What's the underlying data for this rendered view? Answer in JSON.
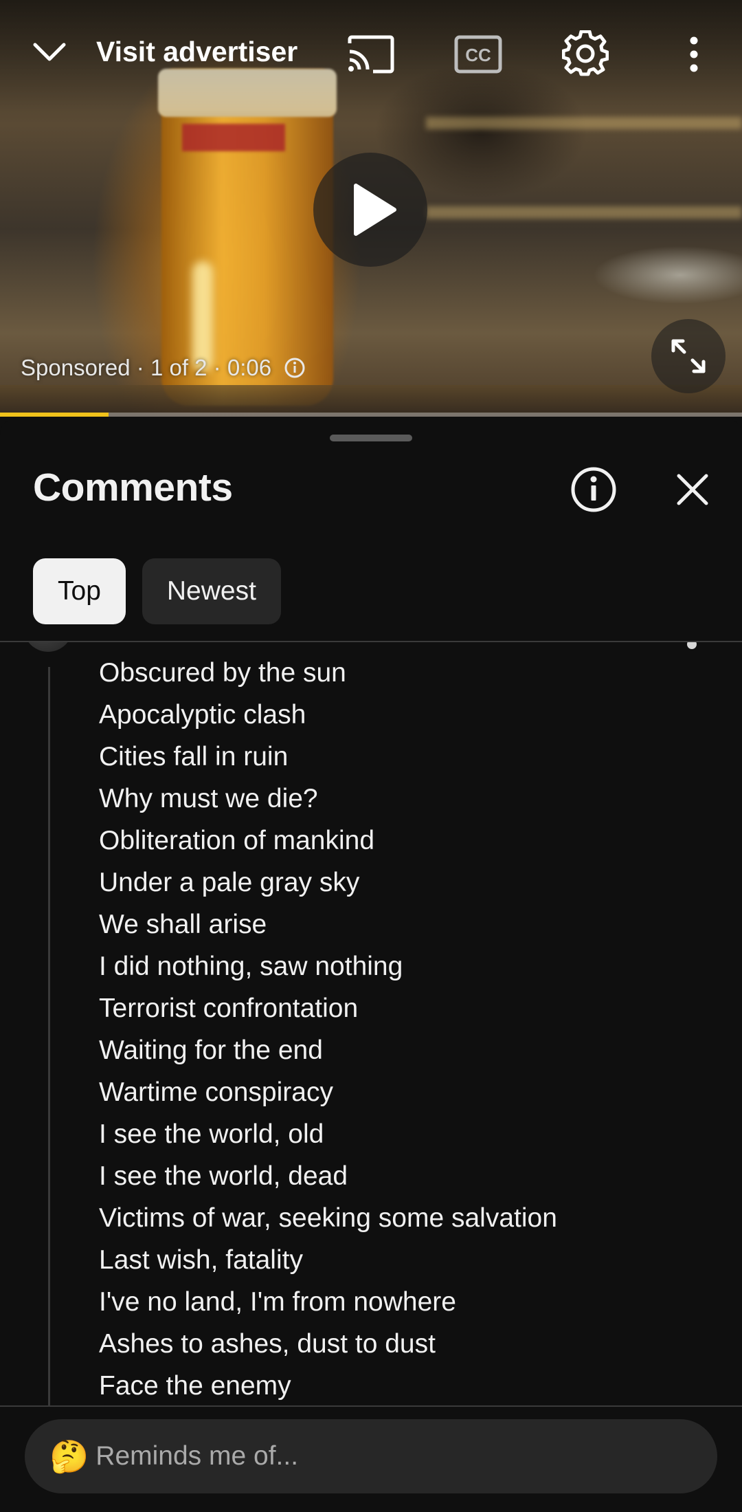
{
  "player": {
    "visit_advertiser": "Visit advertiser",
    "ad_status": "Sponsored · 1 of 2 · 0:06",
    "progress_fraction": 0.146,
    "progress_color": "#f0c21b",
    "icons": [
      "chevron-down-icon",
      "cast-icon",
      "closed-captions-icon",
      "settings-gear-icon",
      "more-vert-icon",
      "play-icon",
      "fullscreen-expand-icon",
      "info-icon"
    ]
  },
  "comments_panel": {
    "title": "Comments",
    "chips": [
      {
        "label": "Top",
        "selected": true
      },
      {
        "label": "Newest",
        "selected": false
      }
    ],
    "comment_lines": [
      "Obscured by the sun",
      "Apocalyptic clash",
      "Cities fall in ruin",
      "Why must we die?",
      "Obliteration of mankind",
      "Under a pale gray sky",
      "We shall arise",
      "I did nothing, saw nothing",
      "Terrorist confrontation",
      "Waiting for the end",
      "Wartime conspiracy",
      "I see the world, old",
      "I see the world, dead",
      "Victims of war, seeking some salvation",
      "Last wish, fatality",
      "I've no land, I'm from nowhere",
      "Ashes to ashes, dust to dust",
      "Face the enemy"
    ],
    "reply_emoji": "🤔",
    "reply_placeholder": "Reminds me of..."
  }
}
